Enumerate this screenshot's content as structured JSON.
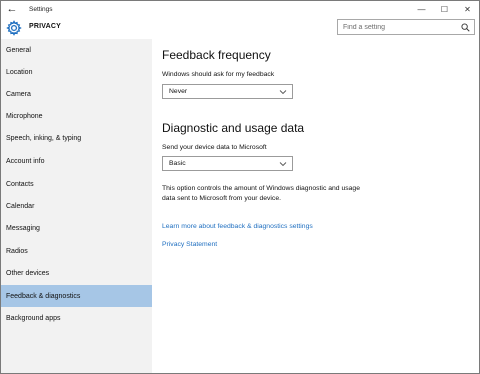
{
  "window": {
    "title": "Settings",
    "back_glyph": "←",
    "controls": {
      "minimize": "—",
      "maximize": "☐",
      "close": "✕"
    }
  },
  "header": {
    "icon": "gear-icon",
    "title": "PRIVACY",
    "search": {
      "placeholder": "Find a setting",
      "value": "",
      "icon": "search-icon"
    }
  },
  "sidebar": {
    "items": [
      {
        "label": "General"
      },
      {
        "label": "Location"
      },
      {
        "label": "Camera"
      },
      {
        "label": "Microphone"
      },
      {
        "label": "Speech, inking, & typing"
      },
      {
        "label": "Account info"
      },
      {
        "label": "Contacts"
      },
      {
        "label": "Calendar"
      },
      {
        "label": "Messaging"
      },
      {
        "label": "Radios"
      },
      {
        "label": "Other devices"
      },
      {
        "label": "Feedback & diagnostics",
        "selected": true
      },
      {
        "label": "Background apps"
      }
    ]
  },
  "main": {
    "feedback": {
      "heading": "Feedback frequency",
      "label": "Windows should ask for my feedback",
      "select_value": "Never"
    },
    "diagnostics": {
      "heading": "Diagnostic and usage data",
      "label": "Send your device data to Microsoft",
      "select_value": "Basic",
      "description_line1": "This option controls the amount of Windows diagnostic and usage",
      "description_line2": "data sent to Microsoft from your device."
    },
    "links": {
      "learn_more": "Learn more about feedback & diagnostics settings",
      "privacy": "Privacy Statement"
    }
  },
  "colors": {
    "selected_nav": "#a6c6e6",
    "sidebar_bg": "#f2f2f2",
    "link": "#1f6fc0",
    "accent_icon": "#1f6fc0"
  }
}
